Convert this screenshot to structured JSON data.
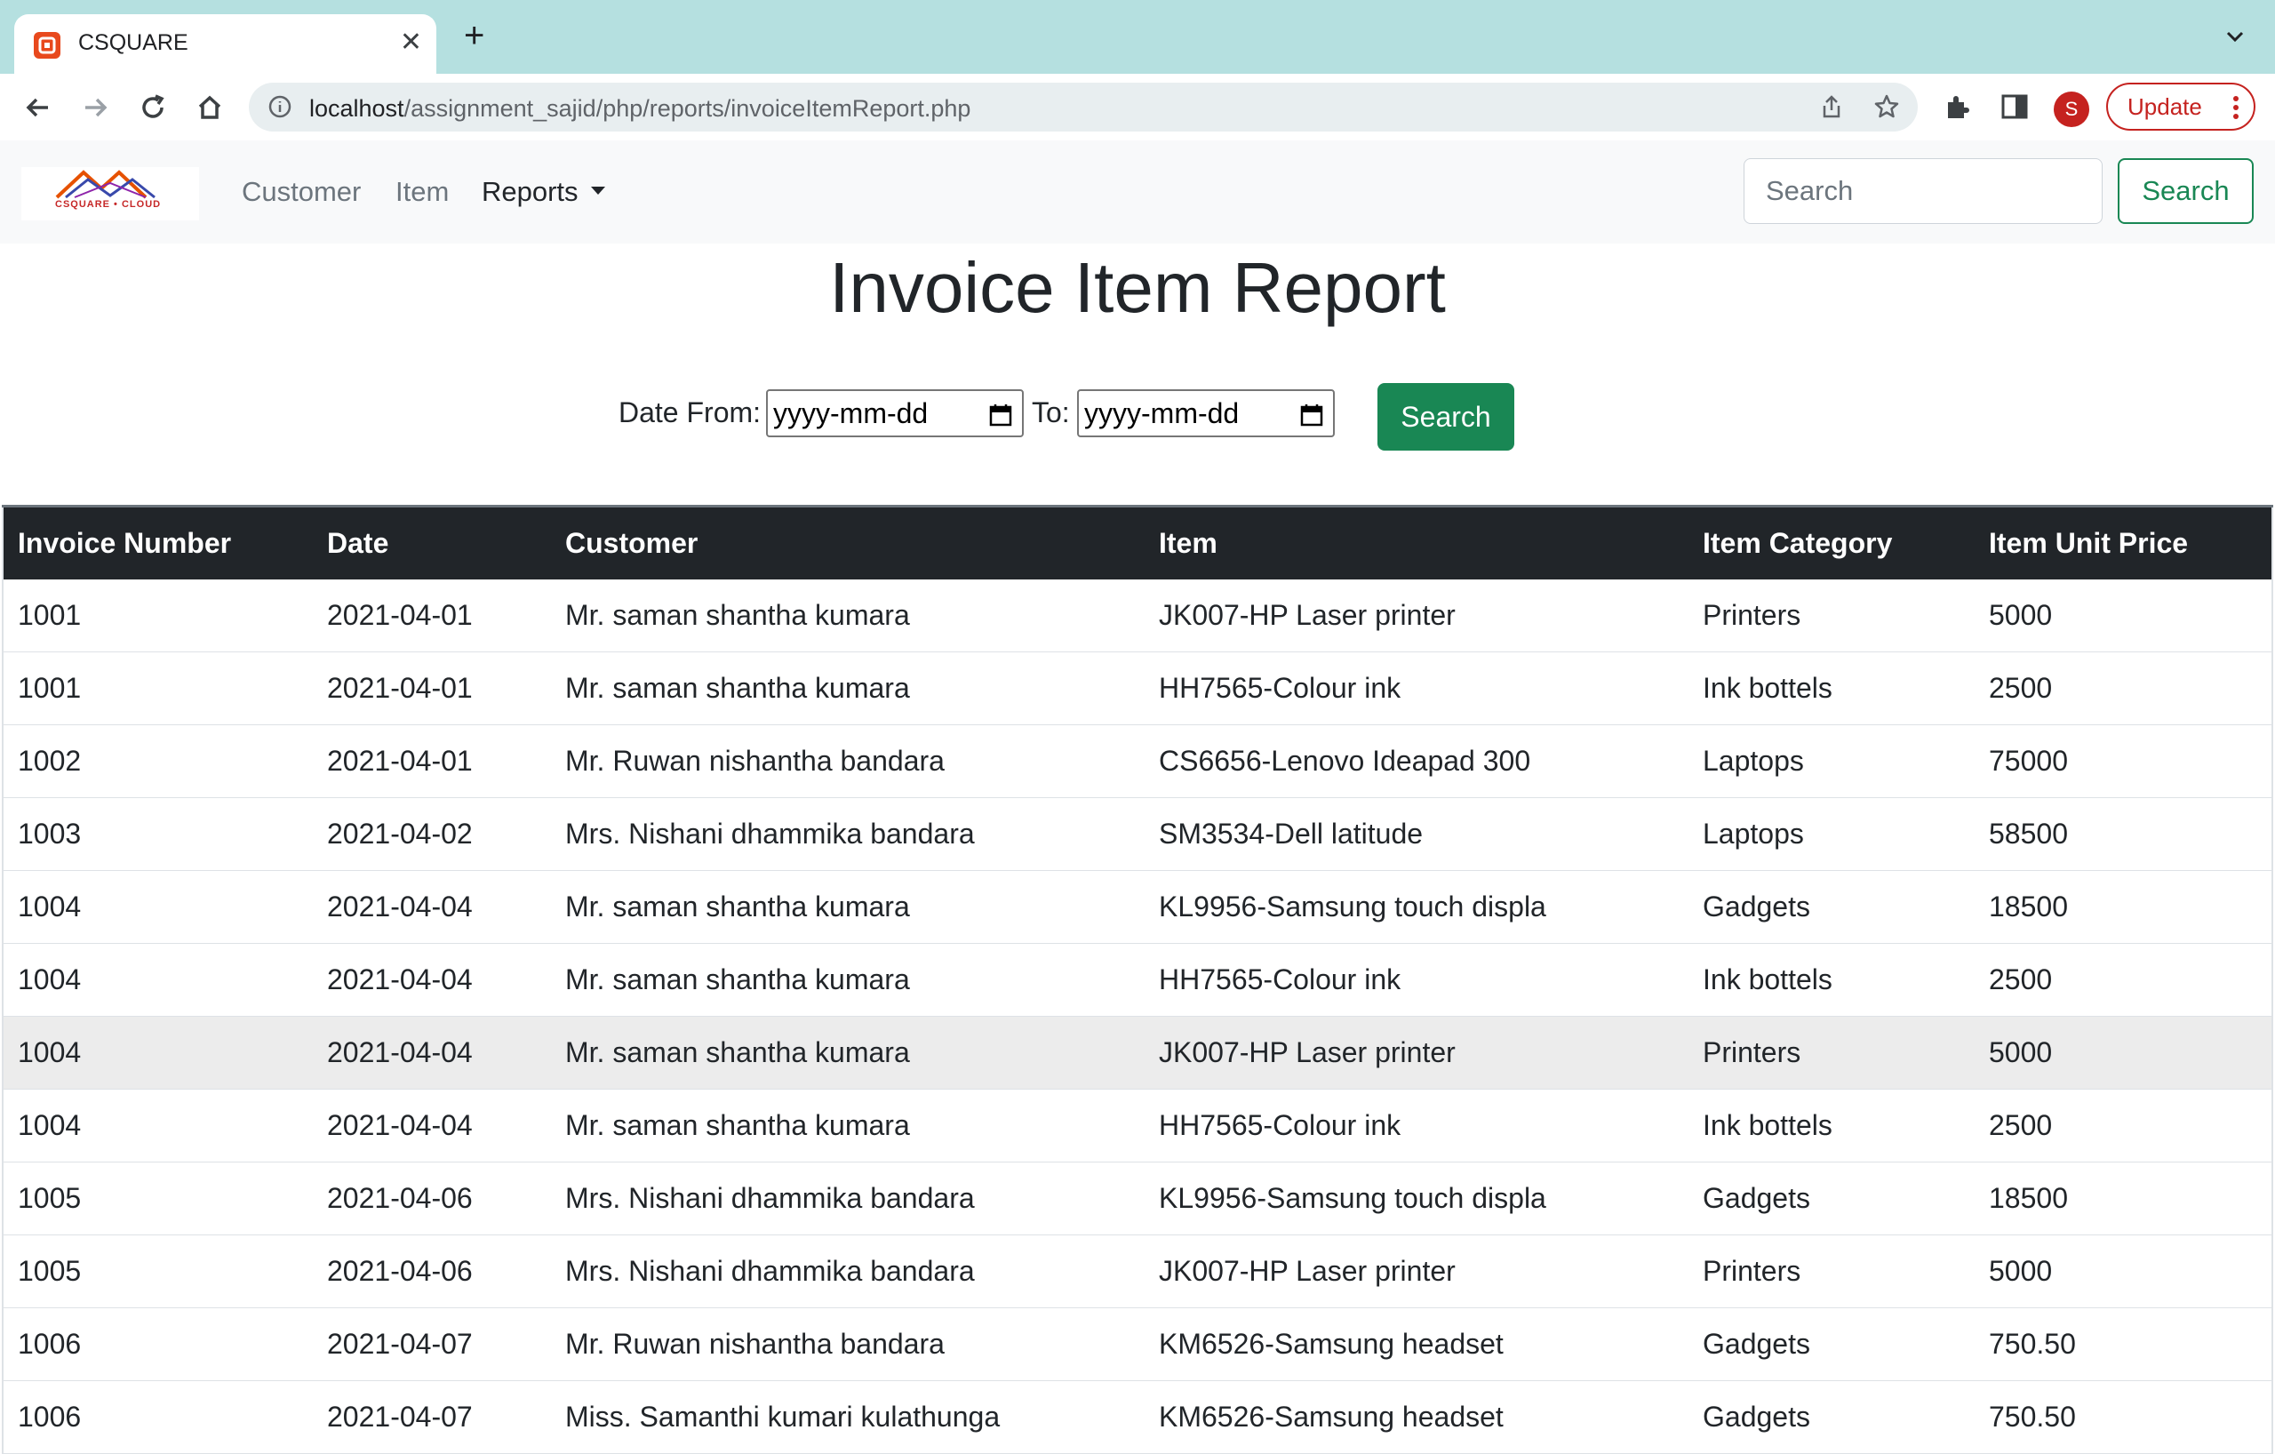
{
  "browser": {
    "tab_title": "CSQUARE",
    "favicon": "csquare-favicon",
    "url_host": "localhost",
    "url_path": "/assignment_sajid/php/reports/invoiceItemReport.php",
    "profile_initial": "S",
    "update_label": "Update"
  },
  "nav": {
    "logo_text": "CSQUARE • CLOUD",
    "links": [
      "Customer",
      "Item",
      "Reports"
    ],
    "search_placeholder": "Search",
    "search_button": "Search"
  },
  "report": {
    "title": "Invoice Item Report",
    "date_from_label": "Date From:",
    "date_to_label": "To:",
    "date_from_value": "yyyy-mm-dd",
    "date_to_value": "yyyy-mm-dd",
    "search_button": "Search"
  },
  "table": {
    "headers": [
      "Invoice Number",
      "Date",
      "Customer",
      "Item",
      "Item Category",
      "Item Unit Price"
    ],
    "rows": [
      [
        "1001",
        "2021-04-01",
        "Mr. saman shantha kumara",
        "JK007-HP Laser printer",
        "Printers",
        "5000"
      ],
      [
        "1001",
        "2021-04-01",
        "Mr. saman shantha kumara",
        "HH7565-Colour ink",
        "Ink bottels",
        "2500"
      ],
      [
        "1002",
        "2021-04-01",
        "Mr. Ruwan nishantha bandara",
        "CS6656-Lenovo Ideapad 300",
        "Laptops",
        "75000"
      ],
      [
        "1003",
        "2021-04-02",
        "Mrs. Nishani dhammika bandara",
        "SM3534-Dell latitude",
        "Laptops",
        "58500"
      ],
      [
        "1004",
        "2021-04-04",
        "Mr. saman shantha kumara",
        "KL9956-Samsung touch displa",
        "Gadgets",
        "18500"
      ],
      [
        "1004",
        "2021-04-04",
        "Mr. saman shantha kumara",
        "HH7565-Colour ink",
        "Ink bottels",
        "2500"
      ],
      [
        "1004",
        "2021-04-04",
        "Mr. saman shantha kumara",
        "JK007-HP Laser printer",
        "Printers",
        "5000"
      ],
      [
        "1004",
        "2021-04-04",
        "Mr. saman shantha kumara",
        "HH7565-Colour ink",
        "Ink bottels",
        "2500"
      ],
      [
        "1005",
        "2021-04-06",
        "Mrs. Nishani dhammika bandara",
        "KL9956-Samsung touch displa",
        "Gadgets",
        "18500"
      ],
      [
        "1005",
        "2021-04-06",
        "Mrs. Nishani dhammika bandara",
        "JK007-HP Laser printer",
        "Printers",
        "5000"
      ],
      [
        "1006",
        "2021-04-07",
        "Mr. Ruwan nishantha bandara",
        "KM6526-Samsung headset",
        "Gadgets",
        "750.50"
      ],
      [
        "1006",
        "2021-04-07",
        "Miss. Samanthi kumari kulathunga",
        "KM6526-Samsung headset",
        "Gadgets",
        "750.50"
      ]
    ],
    "hovered_row": 6
  },
  "colors": {
    "tabstrip": "#b5e0e0",
    "success": "#198754",
    "table_header": "#212529",
    "update_red": "#c5221f"
  }
}
